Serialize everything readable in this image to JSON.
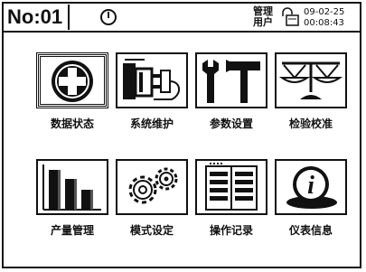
{
  "header": {
    "device_number": "No:01",
    "user_line1": "管理",
    "user_line2": "用户",
    "date": "09-02-25",
    "time": "00:08:43",
    "power_icon": "power-icon",
    "lock_icon": "lock-icon"
  },
  "menu": {
    "items": [
      {
        "label": "数据状态",
        "icon": "first-aid-cross-icon"
      },
      {
        "label": "系统维护",
        "icon": "plug-socket-icon"
      },
      {
        "label": "参数设置",
        "icon": "wrench-hammer-icon"
      },
      {
        "label": "检验校准",
        "icon": "balance-scale-icon"
      },
      {
        "label": "产量管理",
        "icon": "bar-chart-icon"
      },
      {
        "label": "模式设定",
        "icon": "gears-icon"
      },
      {
        "label": "操作记录",
        "icon": "notebook-icon"
      },
      {
        "label": "仪表信息",
        "icon": "info-icon"
      }
    ]
  }
}
